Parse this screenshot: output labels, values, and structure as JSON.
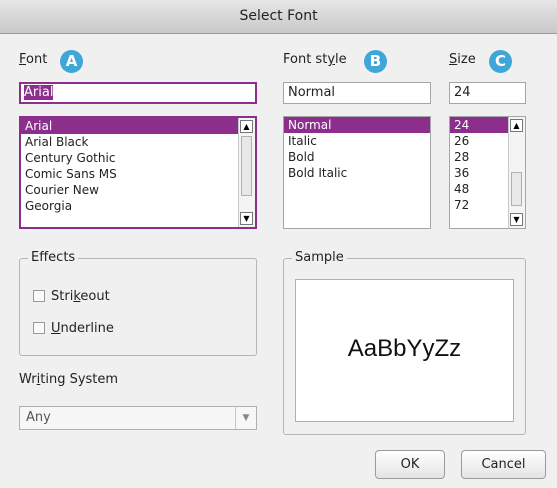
{
  "dialog": {
    "title": "Select Font"
  },
  "font": {
    "label": "Font",
    "accel": "F",
    "label_rest": "ont",
    "badge": "A",
    "value": "Arial",
    "items": [
      {
        "label": "Arial",
        "selected": true
      },
      {
        "label": "Arial Black"
      },
      {
        "label": "Century Gothic"
      },
      {
        "label": "Comic Sans MS"
      },
      {
        "label": "Courier New"
      },
      {
        "label": "Georgia"
      }
    ]
  },
  "style": {
    "label_pre": "Font st",
    "accel": "y",
    "label_post": "le",
    "badge": "B",
    "value": "Normal",
    "items": [
      {
        "label": "Normal",
        "selected": true
      },
      {
        "label": "Italic"
      },
      {
        "label": "Bold"
      },
      {
        "label": "Bold Italic"
      }
    ]
  },
  "size": {
    "accel": "S",
    "label_rest": "ize",
    "badge": "C",
    "value": "24",
    "items": [
      {
        "label": "24",
        "selected": true
      },
      {
        "label": "26"
      },
      {
        "label": "28"
      },
      {
        "label": "36"
      },
      {
        "label": "48"
      },
      {
        "label": "72"
      }
    ]
  },
  "effects": {
    "legend": "Effects",
    "strikeout": {
      "pre": "Stri",
      "accel": "k",
      "post": "eout",
      "checked": false
    },
    "underline": {
      "pre": "",
      "accel": "U",
      "post": "nderline",
      "checked": false
    }
  },
  "writing": {
    "label_pre": "Wr",
    "accel": "i",
    "label_post": "ting System",
    "value": "Any"
  },
  "sample": {
    "legend": "Sample",
    "text": "AaBbYyZz"
  },
  "buttons": {
    "ok": "OK",
    "cancel": "Cancel"
  },
  "colors": {
    "selection": "#8c2f8c",
    "badge": "#3fa6d8"
  }
}
